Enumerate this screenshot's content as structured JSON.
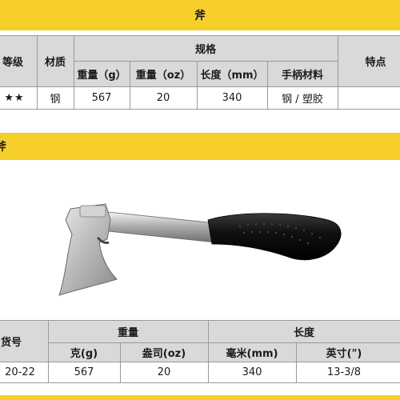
{
  "top_table": {
    "title": "斧",
    "headers": {
      "grade": "等级",
      "material": "材质",
      "spec": "规格",
      "features": "特点",
      "weight_g": "重量（g）",
      "weight_oz": "重量（oz）",
      "length_mm": "长度（mm）",
      "handle_material": "手柄材料"
    },
    "row": {
      "grade": "★★",
      "material": "钢",
      "weight_g": "567",
      "weight_oz": "20",
      "length_mm": "340",
      "handle_material": "钢 / 塑胶",
      "features": ""
    }
  },
  "section": {
    "title": "斧"
  },
  "image": {
    "icon": "hatchet-icon",
    "description_colors": {
      "head": "#c8c8c8",
      "handle_grip": "#111111",
      "shaft": "#d9d9d9"
    }
  },
  "bottom_table": {
    "headers": {
      "model": "货号",
      "weight": "重量",
      "length": "长度",
      "weight_g": "克(g)",
      "weight_oz": "盎司(oz)",
      "length_mm": "毫米(mm)",
      "length_in": "英寸(\")"
    },
    "row": {
      "model": "20-22",
      "weight_g": "567",
      "weight_oz": "20",
      "length_mm": "340",
      "length_in": "13-3/8"
    }
  },
  "colors": {
    "accent_yellow": "#f6cf2b",
    "header_gray": "#d9d9d9"
  }
}
